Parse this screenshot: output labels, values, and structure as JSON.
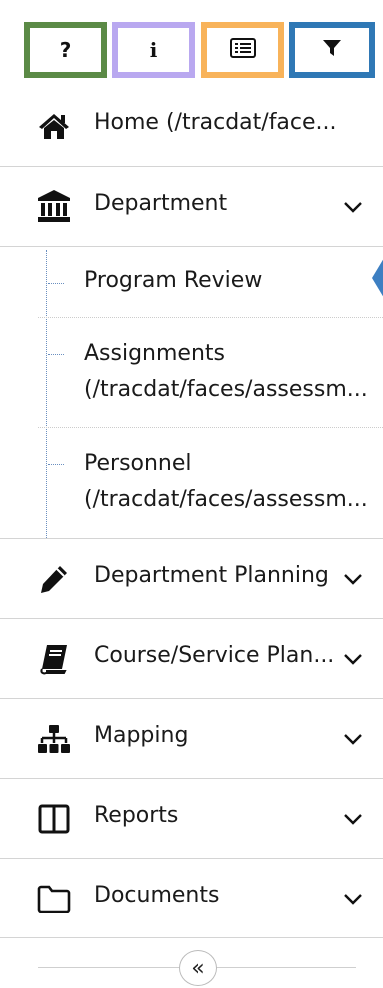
{
  "toolbar": {
    "help": {
      "icon": "question-icon",
      "glyph": "?",
      "color": "#5b8a46"
    },
    "info": {
      "icon": "info-icon",
      "glyph": "i",
      "color": "#b9a8f0"
    },
    "list": {
      "icon": "list-icon",
      "color": "#f8b35a"
    },
    "filter": {
      "icon": "filter-icon",
      "color": "#2f78b5"
    }
  },
  "nav": {
    "home": {
      "label": "Home (/tracdat/face...",
      "icon": "home-icon"
    },
    "department": {
      "label": "Department",
      "icon": "institution-icon",
      "expanded": true,
      "children": [
        {
          "lines": [
            "Program Review"
          ],
          "active": true
        },
        {
          "lines": [
            "Assignments",
            "(/tracdat/faces/assessm..."
          ]
        },
        {
          "lines": [
            "Personnel",
            "(/tracdat/faces/assessm..."
          ]
        }
      ]
    },
    "department_planning": {
      "label": "Department Planning",
      "icon": "pencil-icon"
    },
    "course_service": {
      "label": "Course/Service Plan...",
      "icon": "book-icon"
    },
    "mapping": {
      "label": "Mapping",
      "icon": "sitemap-icon"
    },
    "reports": {
      "label": "Reports",
      "icon": "columns-icon"
    },
    "documents": {
      "label": "Documents",
      "icon": "folder-icon"
    }
  },
  "collapse": {
    "glyph": "«",
    "icon": "double-chevron-left-icon"
  },
  "colors": {
    "active_marker": "#3d7fc2"
  }
}
